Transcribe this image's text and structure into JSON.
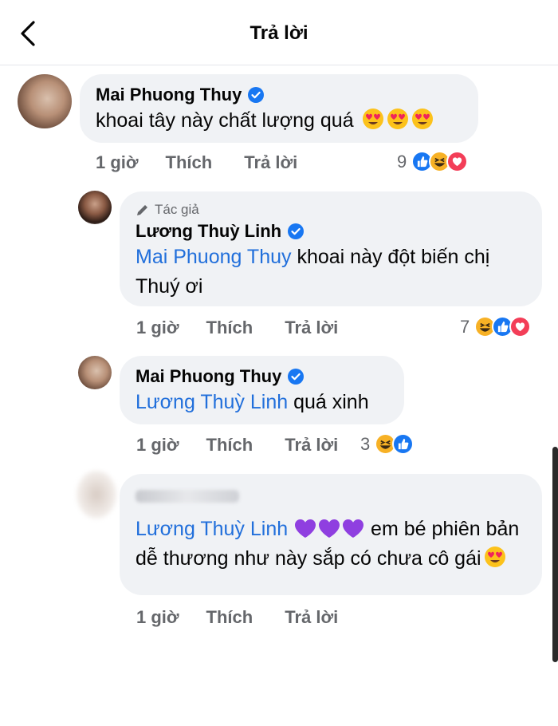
{
  "header": {
    "title": "Trả lời"
  },
  "comments": [
    {
      "author": "Mai Phuong Thuy",
      "text": "khoai tây này chất lượng quá",
      "time": "1 giờ",
      "like_label": "Thích",
      "reply_label": "Trả lời",
      "reaction_count": "9"
    },
    {
      "author_tag": "Tác giả",
      "author": "Lương Thuỳ Linh",
      "mention": "Mai Phuong Thuy",
      "text": "khoai này đột biến chị Thuý ơi",
      "time": "1 giờ",
      "like_label": "Thích",
      "reply_label": "Trả lời",
      "reaction_count": "7"
    },
    {
      "author": "Mai Phuong Thuy",
      "mention": "Lương Thuỳ Linh",
      "text": "quá xinh",
      "time": "1 giờ",
      "like_label": "Thích",
      "reply_label": "Trả lời",
      "reaction_count": "3"
    },
    {
      "mention": "Lương Thuỳ Linh",
      "text": "em bé phiên bản dễ thương như này sắp có chưa cô gái",
      "time": "1 giờ",
      "like_label": "Thích",
      "reply_label": "Trả lời"
    }
  ],
  "colors": {
    "mention": "#216fdb",
    "bubble": "#f0f2f5",
    "meta": "#65676b",
    "like": "#1877f2",
    "love": "#f33e58",
    "haha": "#f7b125"
  },
  "icons": [
    "back-arrow-icon",
    "verified-badge-icon",
    "pencil-icon",
    "like-reaction-icon",
    "haha-reaction-icon",
    "love-reaction-icon",
    "heart-eyes-emoji",
    "purple-heart-emoji"
  ]
}
